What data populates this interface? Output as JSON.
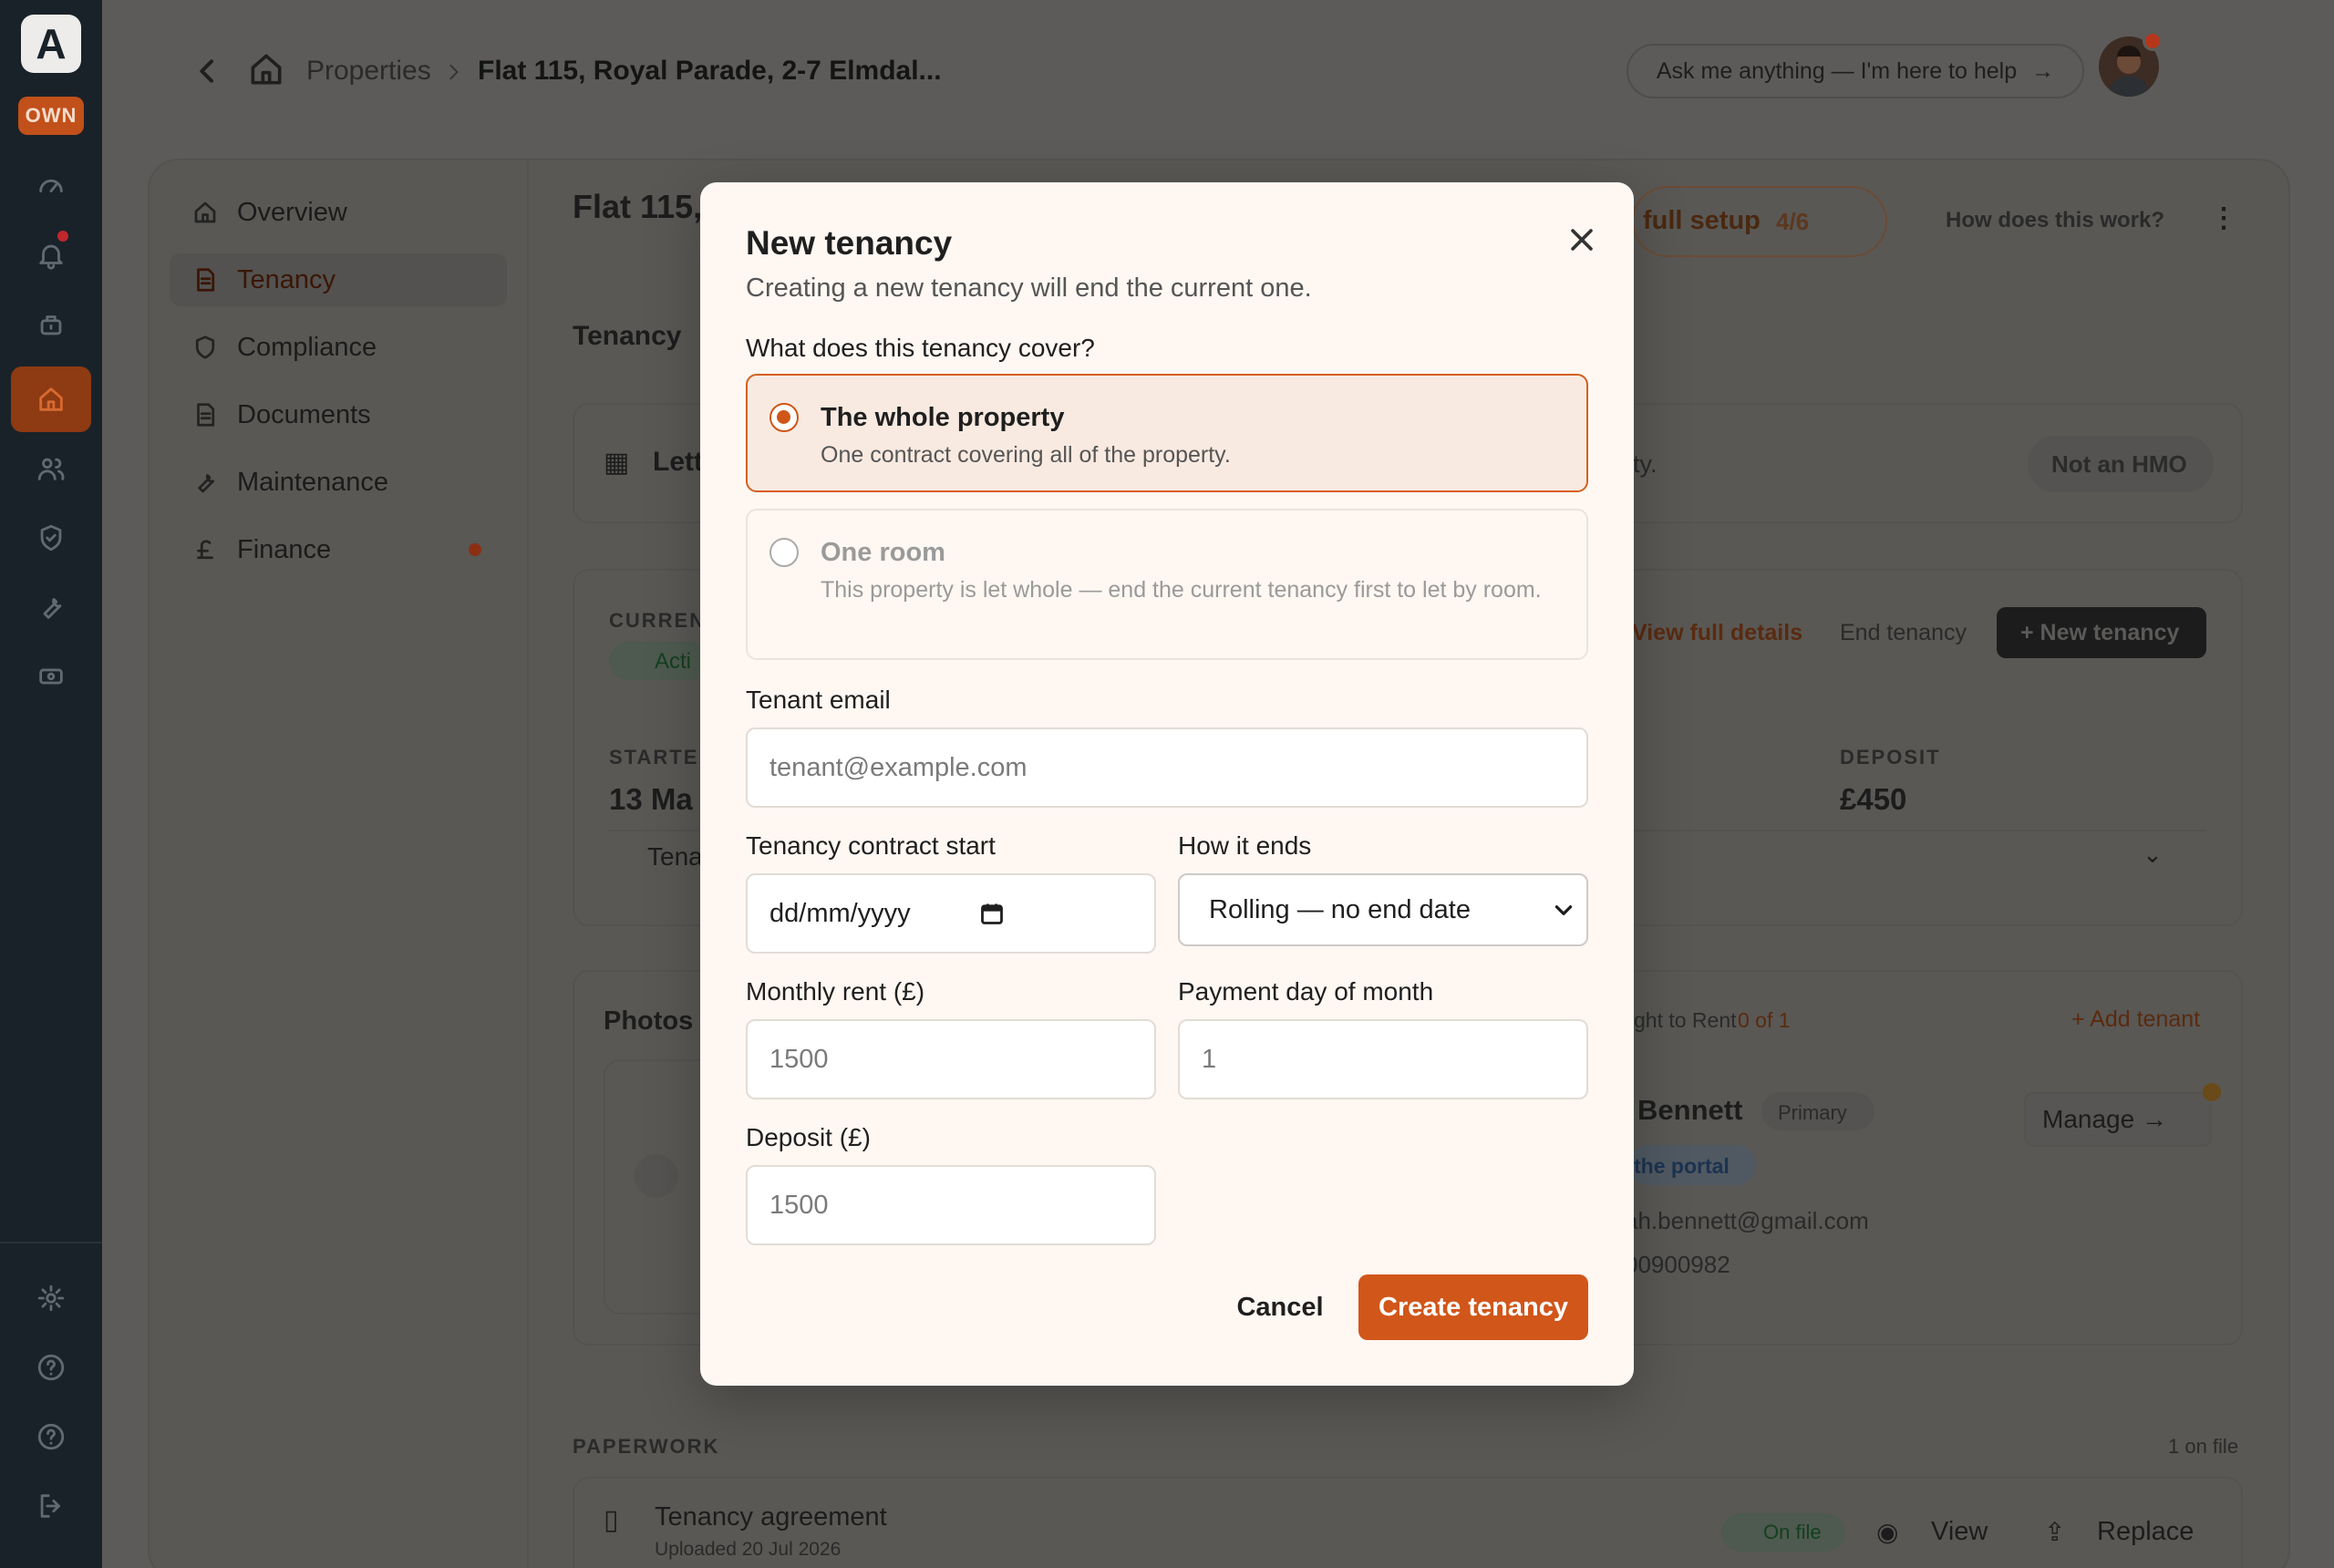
{
  "rail": {
    "logo": "A",
    "badge": "OWN"
  },
  "header": {
    "breadcrumb_root": "Properties",
    "breadcrumb_current": "Flat 115, Royal Parade, 2-7 Elmdal...",
    "ask_label": "Ask me anything — I'm here to help",
    "ask_arrow": "→"
  },
  "sidebar": {
    "items": [
      {
        "label": "Overview",
        "icon": "home-icon"
      },
      {
        "label": "Tenancy",
        "icon": "document-icon"
      },
      {
        "label": "Compliance",
        "icon": "shield-icon"
      },
      {
        "label": "Documents",
        "icon": "file-icon"
      },
      {
        "label": "Maintenance",
        "icon": "wrench-icon"
      },
      {
        "label": "Finance",
        "icon": "pound-icon"
      }
    ]
  },
  "background": {
    "page_title": "Flat 115,",
    "section_title": "Tenancy",
    "setup_label": "full setup",
    "setup_count": "4/6",
    "help_link": "How does this work?",
    "lett_label": "Lett",
    "lett_suffix": "rty.",
    "hmo_badge": "Not an HMO",
    "current_label": "CURREN",
    "active_label": "Acti",
    "view_full": "View full details",
    "end_tenancy": "End tenancy",
    "new_tenancy": "+ New tenancy",
    "started_label": "STARTE",
    "started_value": "13 Ma",
    "deposit_label": "DEPOSIT",
    "deposit_value": "£450",
    "tenants_label": "Tena",
    "photos_title": "Photos",
    "right_to_rent": "ght to Rent",
    "right_to_rent_count": "0 of 1",
    "add_tenant": "+ Add tenant",
    "tenant_name": "Bennett",
    "primary_badge": "Primary",
    "portal_badge": "the portal",
    "manage_label": "Manage →",
    "tenant_email": "ah.bennett@gmail.com",
    "tenant_phone": "00900982",
    "paperwork_label": "PAPERWORK",
    "paperwork_count": "1 on file",
    "doc_title": "Tenancy agreement",
    "doc_uploaded": "Uploaded 20 Jul 2026",
    "on_file": "On file",
    "view_label": "View",
    "replace_label": "Replace"
  },
  "modal": {
    "title": "New tenancy",
    "subtitle": "Creating a new tenancy will end the current one.",
    "cover_question": "What does this tenancy cover?",
    "options": [
      {
        "title": "The whole property",
        "desc": "One contract covering all of the property.",
        "selected": true
      },
      {
        "title": "One room",
        "desc": "This property is let whole — end the current tenancy first to let by room.",
        "selected": false
      }
    ],
    "email_label": "Tenant email",
    "email_placeholder": "tenant@example.com",
    "start_label": "Tenancy contract start",
    "start_placeholder": "dd/mm/yyyy",
    "ends_label": "How it ends",
    "ends_value": "Rolling — no end date",
    "rent_label": "Monthly rent (£)",
    "rent_placeholder": "1500",
    "payday_label": "Payment day of month",
    "payday_placeholder": "1",
    "deposit_label": "Deposit (£)",
    "deposit_placeholder": "1500",
    "cancel_label": "Cancel",
    "create_label": "Create tenancy"
  },
  "colors": {
    "accent": "#d1561a",
    "rail": "#1a2229",
    "modal_bg": "#fef7f2"
  }
}
